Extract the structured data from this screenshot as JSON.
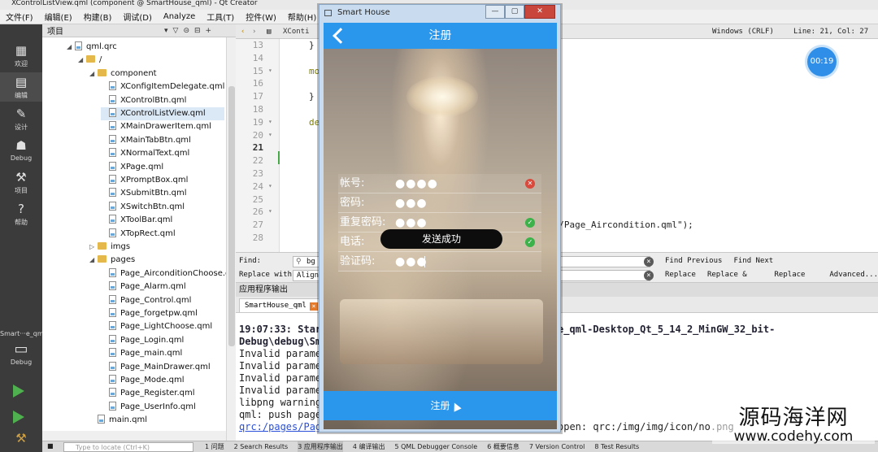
{
  "window": {
    "title": "XControlListView.qml (component @ SmartHouse_qml) - Qt Creator"
  },
  "menu": [
    "文件(F)",
    "编辑(E)",
    "构建(B)",
    "调试(D)",
    "Analyze",
    "工具(T)",
    "控件(W)",
    "帮助(H)"
  ],
  "modes": [
    {
      "label": "欢迎",
      "icon": "grid-icon"
    },
    {
      "label": "编辑",
      "icon": "edit-icon"
    },
    {
      "label": "设计",
      "icon": "pen-icon"
    },
    {
      "label": "Debug",
      "icon": "bug-icon"
    },
    {
      "label": "项目",
      "icon": "wrench-icon"
    },
    {
      "label": "帮助",
      "icon": "help-icon"
    }
  ],
  "kit": {
    "name": "Smart···e_qml",
    "mode": "Debug"
  },
  "project": {
    "header": "项目",
    "tree": [
      {
        "name": "qml.qrc",
        "type": "qrc",
        "depth": 0,
        "expanded": true
      },
      {
        "name": "/",
        "type": "folder",
        "depth": 1,
        "expanded": true
      },
      {
        "name": "component",
        "type": "folder",
        "depth": 2,
        "expanded": true
      },
      {
        "name": "XConfigItemDelegate.qml",
        "type": "file",
        "depth": 3
      },
      {
        "name": "XControlBtn.qml",
        "type": "file",
        "depth": 3
      },
      {
        "name": "XControlListView.qml",
        "type": "file",
        "depth": 3,
        "selected": true
      },
      {
        "name": "XMainDrawerItem.qml",
        "type": "file",
        "depth": 3
      },
      {
        "name": "XMainTabBtn.qml",
        "type": "file",
        "depth": 3
      },
      {
        "name": "XNormalText.qml",
        "type": "file",
        "depth": 3
      },
      {
        "name": "XPage.qml",
        "type": "file",
        "depth": 3
      },
      {
        "name": "XPromptBox.qml",
        "type": "file",
        "depth": 3
      },
      {
        "name": "XSubmitBtn.qml",
        "type": "file",
        "depth": 3
      },
      {
        "name": "XSwitchBtn.qml",
        "type": "file",
        "depth": 3
      },
      {
        "name": "XToolBar.qml",
        "type": "file",
        "depth": 3
      },
      {
        "name": "XTopRect.qml",
        "type": "file",
        "depth": 3
      },
      {
        "name": "imgs",
        "type": "folder",
        "depth": 2,
        "expanded": false
      },
      {
        "name": "pages",
        "type": "folder",
        "depth": 2,
        "expanded": true
      },
      {
        "name": "Page_AirconditionChoose.qml",
        "type": "file",
        "depth": 3
      },
      {
        "name": "Page_Alarm.qml",
        "type": "file",
        "depth": 3
      },
      {
        "name": "Page_Control.qml",
        "type": "file",
        "depth": 3
      },
      {
        "name": "Page_forgetpw.qml",
        "type": "file",
        "depth": 3
      },
      {
        "name": "Page_LightChoose.qml",
        "type": "file",
        "depth": 3
      },
      {
        "name": "Page_Login.qml",
        "type": "file",
        "depth": 3
      },
      {
        "name": "Page_main.qml",
        "type": "file",
        "depth": 3
      },
      {
        "name": "Page_MainDrawer.qml",
        "type": "file",
        "depth": 3
      },
      {
        "name": "Page_Mode.qml",
        "type": "file",
        "depth": 3
      },
      {
        "name": "Page_Register.qml",
        "type": "file",
        "depth": 3
      },
      {
        "name": "Page_UserInfo.qml",
        "type": "file",
        "depth": 3
      },
      {
        "name": "main.qml",
        "type": "file",
        "depth": 2
      }
    ]
  },
  "editor": {
    "tab": "XConti",
    "encoding": "Windows (CRLF)",
    "position": "Line: 21, Col: 27",
    "current_line": 21,
    "lines": [
      {
        "n": 13,
        "text": "}"
      },
      {
        "n": 14,
        "text": ""
      },
      {
        "n": 15,
        "text": "mo",
        "fold": true
      },
      {
        "n": 16,
        "text": ""
      },
      {
        "n": 17,
        "text": "}"
      },
      {
        "n": 18,
        "text": ""
      },
      {
        "n": 19,
        "text": "de",
        "fold": true
      },
      {
        "n": 20,
        "text": "",
        "fold": true
      },
      {
        "n": 21,
        "text": ""
      },
      {
        "n": 22,
        "text": ""
      },
      {
        "n": 23,
        "text": ""
      },
      {
        "n": 24,
        "text": "",
        "fold": true
      },
      {
        "n": 25,
        "text": ""
      },
      {
        "n": 26,
        "text": "",
        "fold": true
      },
      {
        "n": 27,
        "text": "es/Page_Aircondition.qml\");"
      },
      {
        "n": 28,
        "text": ""
      }
    ]
  },
  "timer": "00:19",
  "find": {
    "find_label": "Find:",
    "find_value": "bg",
    "replace_label": "Replace with:",
    "replace_value": "AlignL",
    "find_previous": "Find Previous",
    "find_next": "Find Next",
    "replace": "Replace",
    "replace_find": "Replace & Find",
    "replace_all": "Replace All",
    "advanced": "Advanced..."
  },
  "output": {
    "header": "应用程序输出",
    "tab": "SmartHouse_qml",
    "lines": [
      {
        "text": "",
        "style": "normal"
      },
      {
        "text": "19:07:33: Star",
        "tail": "e_qml-Desktop_Qt_5_14_2_MinGW_32_bit-",
        "style": "bold"
      },
      {
        "text": "Debug\\debug\\Sm",
        "style": "bold"
      },
      {
        "text": "Invalid parame",
        "style": "normal"
      },
      {
        "text": "Invalid parame",
        "style": "normal"
      },
      {
        "text": "Invalid parame",
        "style": "normal"
      },
      {
        "text": "Invalid parame",
        "style": "normal"
      },
      {
        "text": "libpng warning",
        "style": "normal"
      },
      {
        "text": "qml: push page",
        "style": "normal"
      },
      {
        "text": "qrc:/pages/Pag",
        "tail": "open: qrc:/img/img/icon/no.png",
        "style": "link"
      }
    ]
  },
  "statusbar": {
    "locate_placeholder": "Type to locate (Ctrl+K)",
    "panes": [
      {
        "label": "1 问题"
      },
      {
        "label": "2 Search Results"
      },
      {
        "label": "3 应用程序输出",
        "active": true
      },
      {
        "label": "4 编译输出"
      },
      {
        "label": "5 QML Debugger Console"
      },
      {
        "label": "6 概要信息"
      },
      {
        "label": "7 Version Control"
      },
      {
        "label": "8 Test Results"
      }
    ]
  },
  "app": {
    "window_title": "Smart House",
    "page_title": "注册",
    "fields": [
      {
        "label": "帐号:",
        "value": "●●●●",
        "status": "error"
      },
      {
        "label": "密码:",
        "value": "●●●",
        "status": "none"
      },
      {
        "label": "重复密码:",
        "value": "●●●",
        "status": "ok"
      },
      {
        "label": "电话:",
        "value": "",
        "status": "ok"
      },
      {
        "label": "验证码:",
        "value": "●●●",
        "status": "none"
      }
    ],
    "toast": "发送成功",
    "submit": "注册"
  },
  "watermark": {
    "line1": "源码海洋网",
    "line2": "www.codehy.com"
  },
  "colors": {
    "accent": "#2a97ec",
    "ok": "#3db24a",
    "error": "#d94a3c"
  }
}
